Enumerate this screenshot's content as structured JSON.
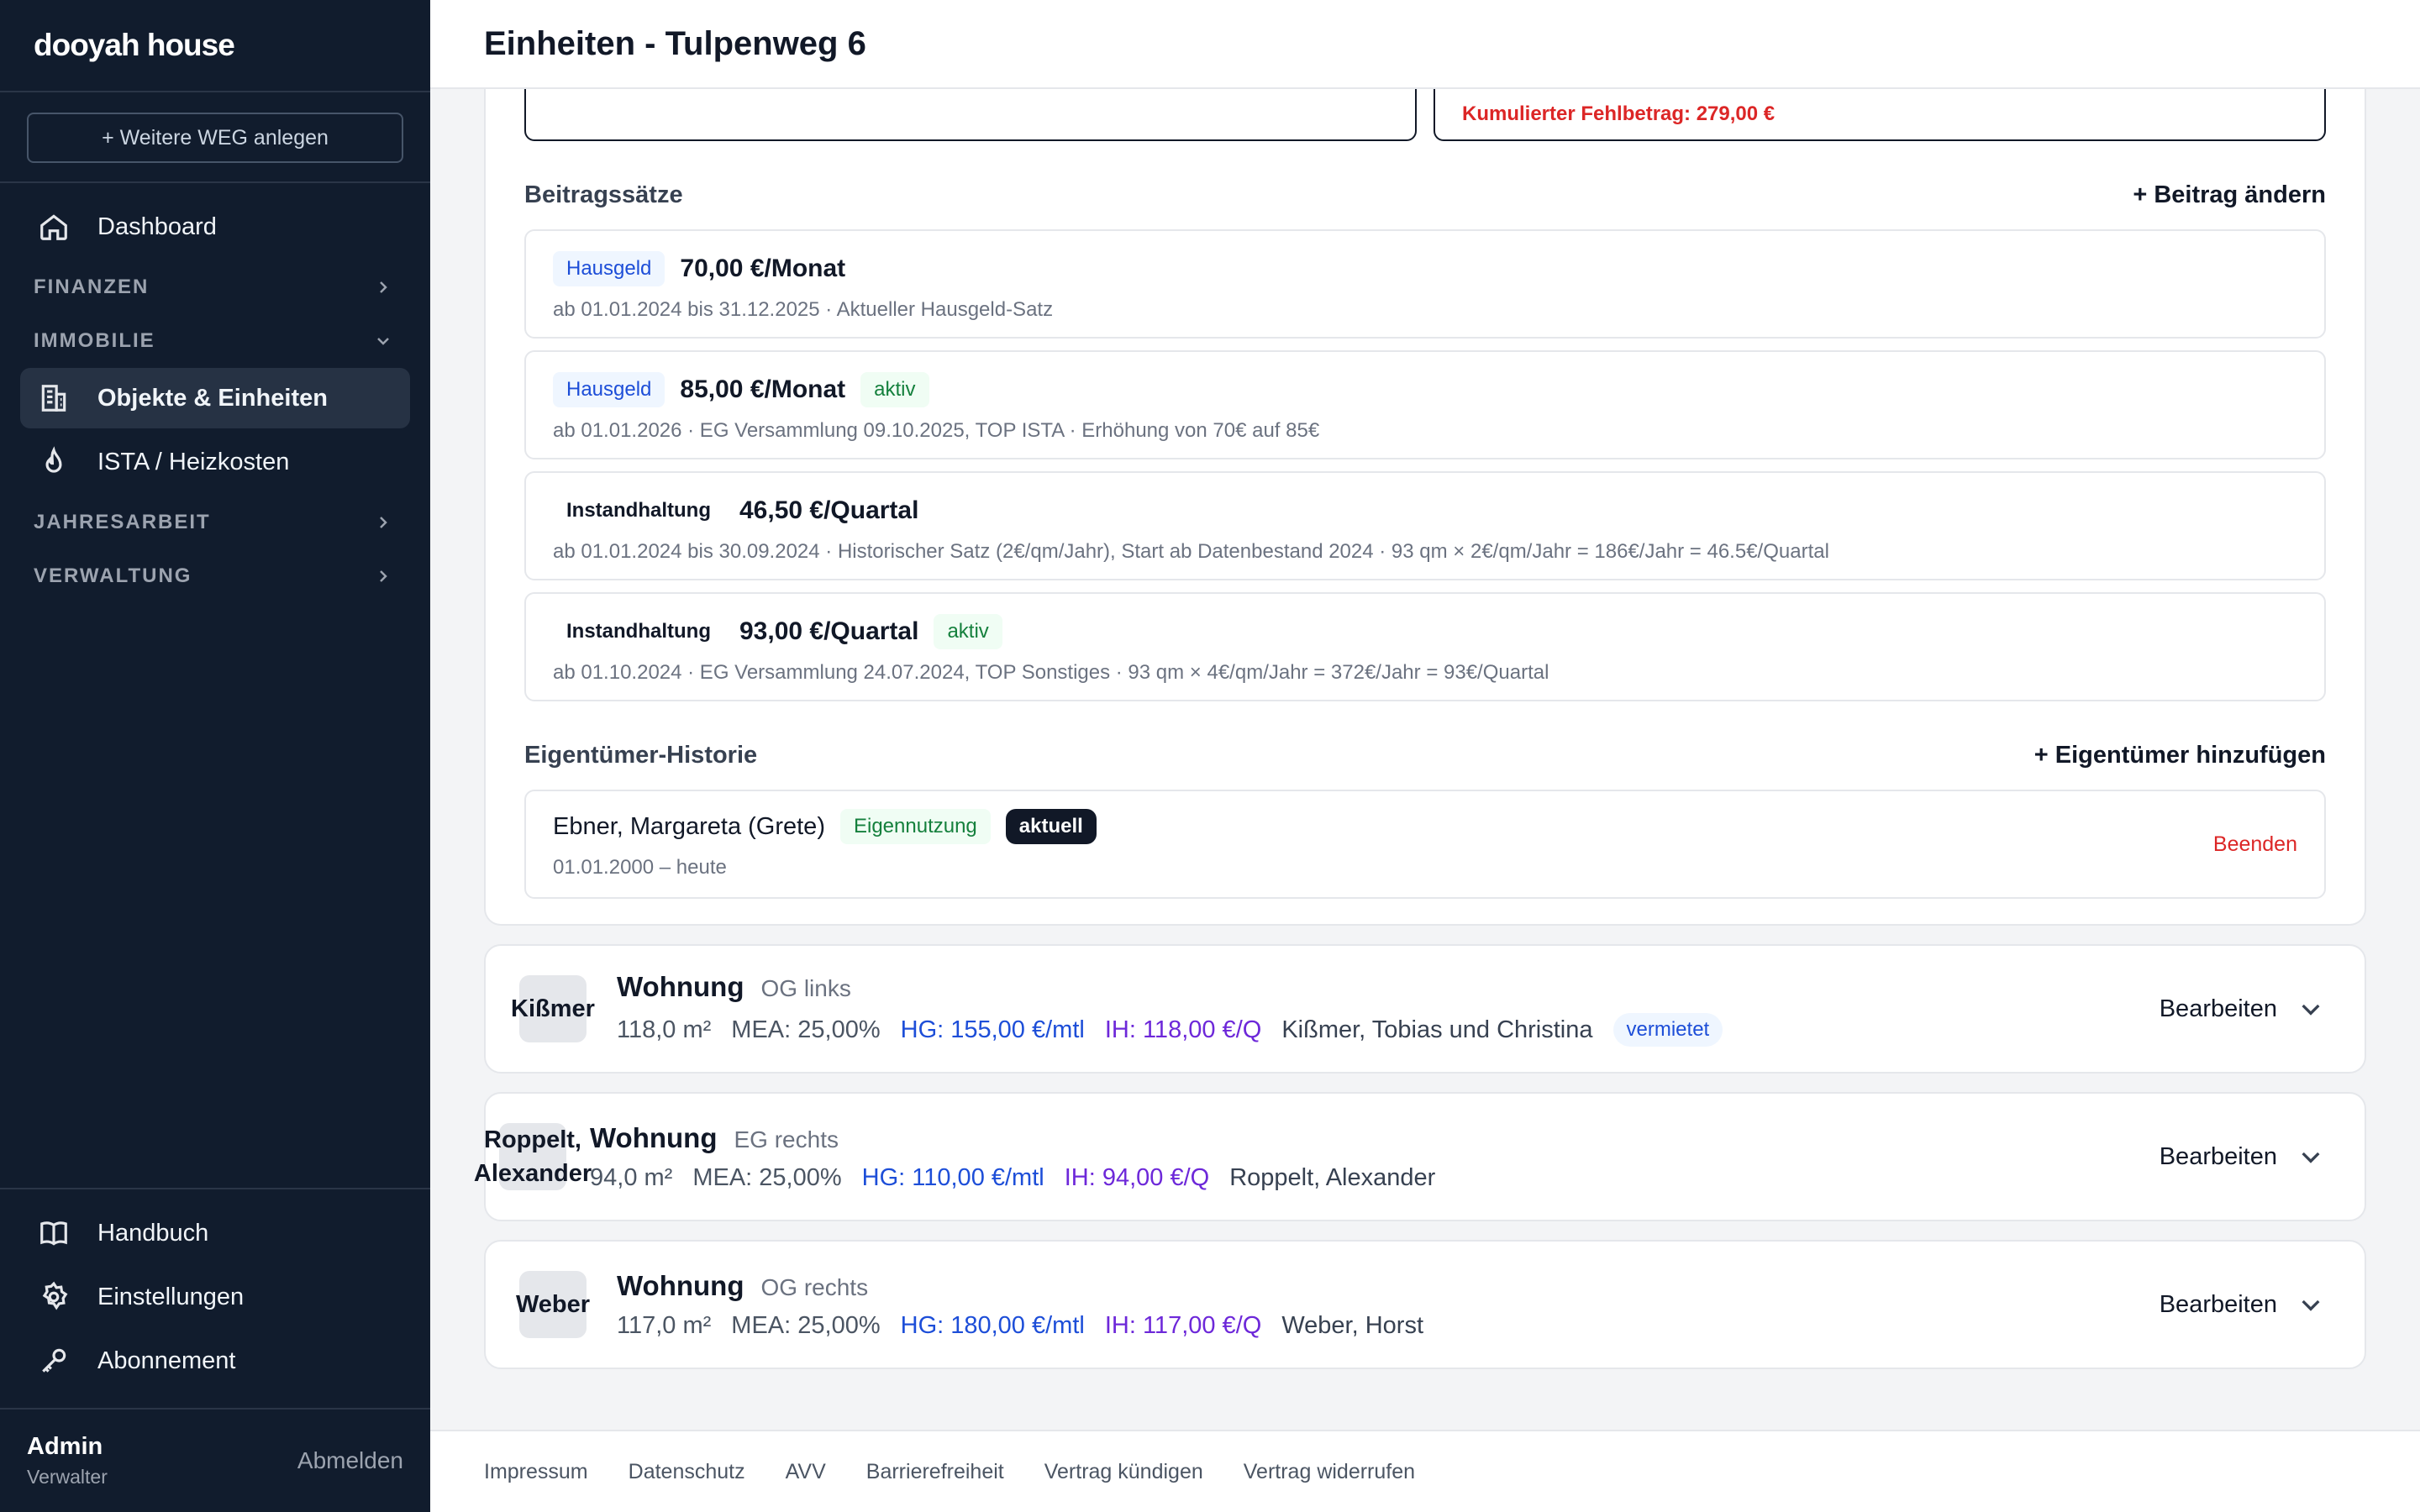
{
  "brand": "dooyah house",
  "sidebar": {
    "new_weg": "+ Weitere WEG anlegen",
    "dashboard": "Dashboard",
    "sections": {
      "finanzen": "FINANZEN",
      "immobilie": "IMMOBILIE",
      "jahresarbeit": "JAHRESARBEIT",
      "verwaltung": "VERWALTUNG"
    },
    "items": {
      "objekte": "Objekte & Einheiten",
      "ista": "ISTA / Heizkosten"
    },
    "bottom": {
      "handbuch": "Handbuch",
      "einstellungen": "Einstellungen",
      "abonnement": "Abonnement"
    },
    "user": {
      "name": "Admin",
      "role": "Verwalter",
      "logout": "Abmelden"
    }
  },
  "header": {
    "title": "Einheiten - Tulpenweg 6"
  },
  "unit_detail": {
    "missing_amount": "Kumulierter Fehlbetrag: 279,00 €",
    "rates_title": "Beitragssätze",
    "rates_action": "+ Beitrag ändern",
    "rates": [
      {
        "type": "Hausgeld",
        "amount": "70,00 €/Monat",
        "status": "",
        "desc": "ab 01.01.2024 bis 31.12.2025 · Aktueller Hausgeld-Satz"
      },
      {
        "type": "Hausgeld",
        "amount": "85,00 €/Monat",
        "status": "aktiv",
        "desc": "ab 01.01.2026 · EG Versammlung 09.10.2025, TOP ISTA · Erhöhung von 70€ auf 85€"
      },
      {
        "type": "Instandhaltung",
        "amount": "46,50 €/Quartal",
        "status": "",
        "desc": "ab 01.01.2024 bis 30.09.2024 · Historischer Satz (2€/qm/Jahr), Start ab Datenbestand 2024 · 93 qm × 2€/qm/Jahr = 186€/Jahr = 46.5€/Quartal"
      },
      {
        "type": "Instandhaltung",
        "amount": "93,00 €/Quartal",
        "status": "aktiv",
        "desc": "ab 01.10.2024 · EG Versammlung 24.07.2024, TOP Sonstiges · 93 qm × 4€/qm/Jahr = 372€/Jahr = 93€/Quartal"
      }
    ],
    "owners_title": "Eigentümer-Historie",
    "owners_action": "+ Eigentümer hinzufügen",
    "owner": {
      "name": "Ebner, Margareta (Grete)",
      "usage": "Eigennutzung",
      "status": "aktuell",
      "period": "01.01.2000 – heute",
      "end_label": "Beenden"
    }
  },
  "units": [
    {
      "avatar": "Kißmer",
      "type": "Wohnung",
      "location": "OG links",
      "area": "118,0 m²",
      "mea": "MEA: 25,00%",
      "hg": "HG: 155,00 €/mtl",
      "ih": "IH: 118,00 €/Q",
      "owner": "Kißmer, Tobias und Christina",
      "badge": "vermietet",
      "edit": "Bearbeiten"
    },
    {
      "avatar": "Roppelt, Alexander",
      "type": "Wohnung",
      "location": "EG rechts",
      "area": "94,0 m²",
      "mea": "MEA: 25,00%",
      "hg": "HG: 110,00 €/mtl",
      "ih": "IH: 94,00 €/Q",
      "owner": "Roppelt, Alexander",
      "badge": "",
      "edit": "Bearbeiten"
    },
    {
      "avatar": "Weber",
      "type": "Wohnung",
      "location": "OG rechts",
      "area": "117,0 m²",
      "mea": "MEA: 25,00%",
      "hg": "HG: 180,00 €/mtl",
      "ih": "IH: 117,00 €/Q",
      "owner": "Weber, Horst",
      "badge": "",
      "edit": "Bearbeiten"
    }
  ],
  "footer": [
    "Impressum",
    "Datenschutz",
    "AVV",
    "Barrierefreiheit",
    "Vertrag kündigen",
    "Vertrag widerrufen"
  ]
}
